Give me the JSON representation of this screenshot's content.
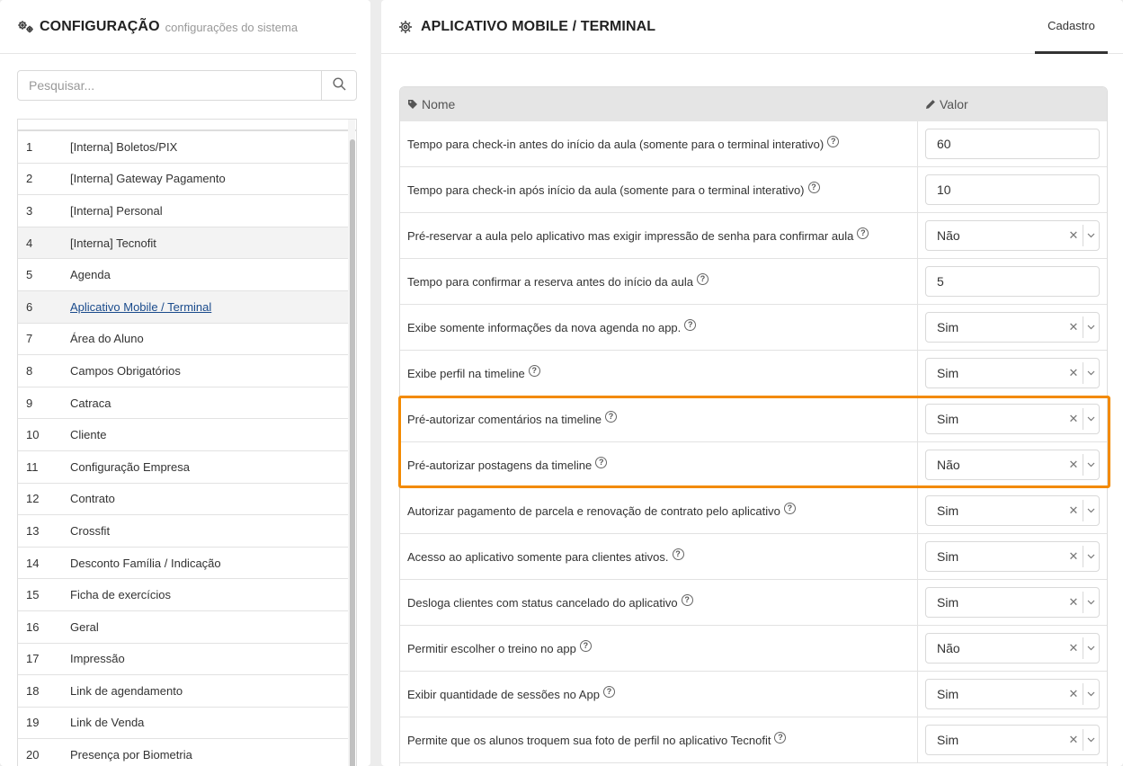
{
  "left": {
    "title": "CONFIGURAÇÃO",
    "subtitle": "configurações do sistema",
    "search_placeholder": "Pesquisar...",
    "items": [
      {
        "num": "1",
        "label": "[Interna] Boletos/PIX"
      },
      {
        "num": "2",
        "label": "[Interna] Gateway Pagamento"
      },
      {
        "num": "3",
        "label": "[Interna] Personal"
      },
      {
        "num": "4",
        "label": "[Interna] Tecnofit"
      },
      {
        "num": "5",
        "label": "Agenda"
      },
      {
        "num": "6",
        "label": "Aplicativo Mobile / Terminal"
      },
      {
        "num": "7",
        "label": "Área do Aluno"
      },
      {
        "num": "8",
        "label": "Campos Obrigatórios"
      },
      {
        "num": "9",
        "label": "Catraca"
      },
      {
        "num": "10",
        "label": "Cliente"
      },
      {
        "num": "11",
        "label": "Configuração Empresa"
      },
      {
        "num": "12",
        "label": "Contrato"
      },
      {
        "num": "13",
        "label": "Crossfit"
      },
      {
        "num": "14",
        "label": "Desconto Família / Indicação"
      },
      {
        "num": "15",
        "label": "Ficha de exercícios"
      },
      {
        "num": "16",
        "label": "Geral"
      },
      {
        "num": "17",
        "label": "Impressão"
      },
      {
        "num": "18",
        "label": "Link de agendamento"
      },
      {
        "num": "19",
        "label": "Link de Venda"
      },
      {
        "num": "20",
        "label": "Presença por Biometria"
      }
    ]
  },
  "right": {
    "title": "APLICATIVO MOBILE / TERMINAL",
    "tab": "Cadastro",
    "col_name": "Nome",
    "col_value": "Valor",
    "rows": [
      {
        "name": "Tempo para check-in antes do início da aula (somente para o terminal interativo)",
        "value": "60"
      },
      {
        "name": "Tempo para check-in após início da aula (somente para o terminal interativo)",
        "value": "10"
      },
      {
        "name": "Pré-reservar a aula pelo aplicativo mas exigir impressão de senha para confirmar aula",
        "value": "Não"
      },
      {
        "name": "Tempo para confirmar a reserva antes do início da aula",
        "value": "5"
      },
      {
        "name": "Exibe somente informações da nova agenda no app.",
        "value": "Sim"
      },
      {
        "name": "Exibe perfil na timeline",
        "value": "Sim"
      },
      {
        "name": "Pré-autorizar comentários na timeline",
        "value": "Sim"
      },
      {
        "name": "Pré-autorizar postagens da timeline",
        "value": "Não"
      },
      {
        "name": "Autorizar pagamento de parcela e renovação de contrato pelo aplicativo",
        "value": "Sim"
      },
      {
        "name": "Acesso ao aplicativo somente para clientes ativos.",
        "value": "Sim"
      },
      {
        "name": "Desloga clientes com status cancelado do aplicativo",
        "value": "Sim"
      },
      {
        "name": "Permitir escolher o treino no app",
        "value": "Não"
      },
      {
        "name": "Exibir quantidade de sessões no App",
        "value": "Sim"
      },
      {
        "name": "Permite que os alunos troquem sua foto de perfil no aplicativo Tecnofit",
        "value": "Sim"
      }
    ]
  }
}
